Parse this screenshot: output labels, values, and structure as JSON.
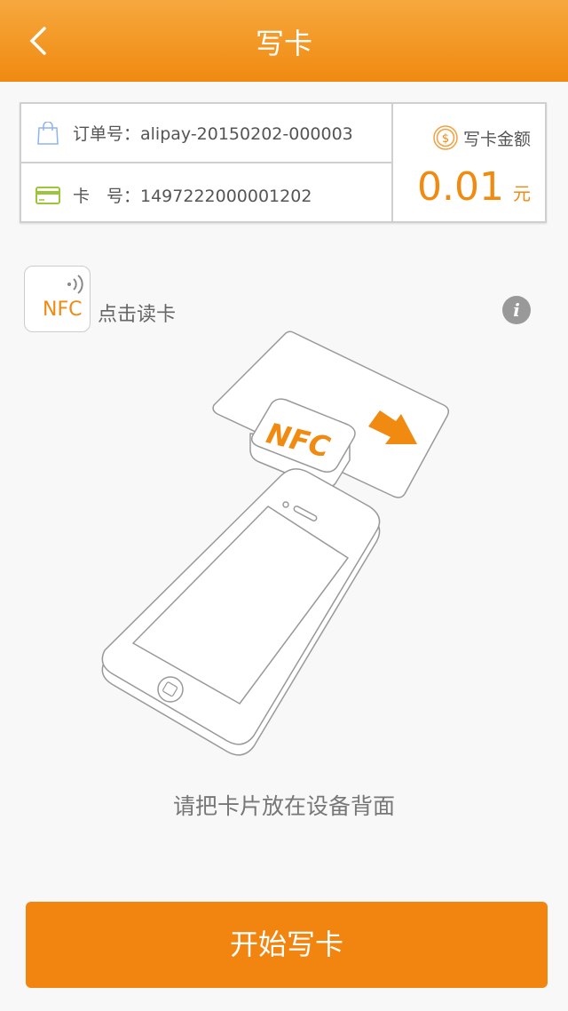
{
  "header": {
    "title": "写卡",
    "back_icon": "chevron-left-icon"
  },
  "order": {
    "label": "订单号：alipay-20150202-000003",
    "icon": "shopping-bag-icon"
  },
  "card": {
    "label": "卡　号：1497222000001202",
    "icon": "credit-card-icon"
  },
  "amount": {
    "label": "写卡金额",
    "value": "0.01",
    "unit": "元",
    "icon": "coin-icon",
    "accent": "#f08a10"
  },
  "nfc": {
    "badge": "NFC",
    "label": "点击读卡",
    "info": "i"
  },
  "illustration": {
    "nfc_text": "NFC"
  },
  "hint": "请把卡片放在设备背面",
  "button": {
    "label": "开始写卡",
    "color": "#f2850f"
  }
}
